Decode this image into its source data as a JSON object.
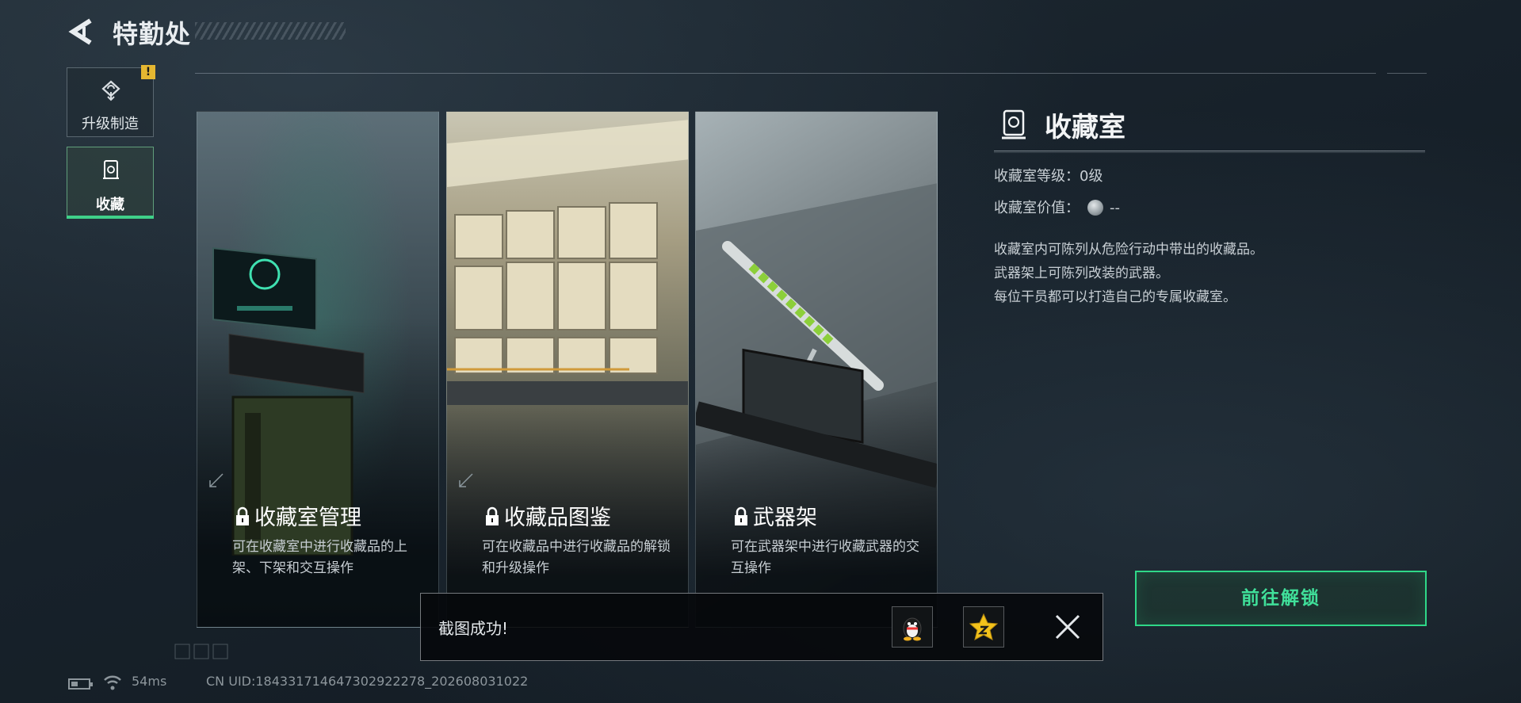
{
  "header": {
    "title": "特勤处"
  },
  "sidebar": {
    "items": [
      {
        "label": "升级制造",
        "icon": "upgrade-cycle-icon",
        "alert": "!"
      },
      {
        "label": "收藏",
        "icon": "collection-vault-icon",
        "active": true
      }
    ]
  },
  "cards": [
    {
      "title": "收藏室管理",
      "desc": "可在收藏室中进行收藏品的上架、下架和交互操作",
      "locked": true
    },
    {
      "title": "收藏品图鉴",
      "desc": "可在收藏品中进行收藏品的解锁和升级操作",
      "locked": true
    },
    {
      "title": "武器架",
      "desc": "可在武器架中进行收藏武器的交互操作",
      "locked": true
    }
  ],
  "info": {
    "title": "收藏室",
    "level_label": "收藏室等级：",
    "level_value": "0级",
    "value_label": "收藏室价值：",
    "value_value": "--",
    "description": [
      "收藏室内可陈列从危险行动中带出的收藏品。",
      "武器架上可陈列改装的武器。",
      "每位干员都可以打造自己的专属收藏室。"
    ],
    "unlock_button": "前往解锁"
  },
  "toast": {
    "message": "截图成功!",
    "share_buttons": [
      "qq-penguin-icon",
      "qzone-star-icon"
    ]
  },
  "status_bar": {
    "ping": "54ms",
    "uid": "CN UID:18433171464730292227​8_202608031022"
  },
  "colors": {
    "accent_green": "#2fd888",
    "alert_yellow": "#e5b731",
    "background": "#17212a"
  }
}
